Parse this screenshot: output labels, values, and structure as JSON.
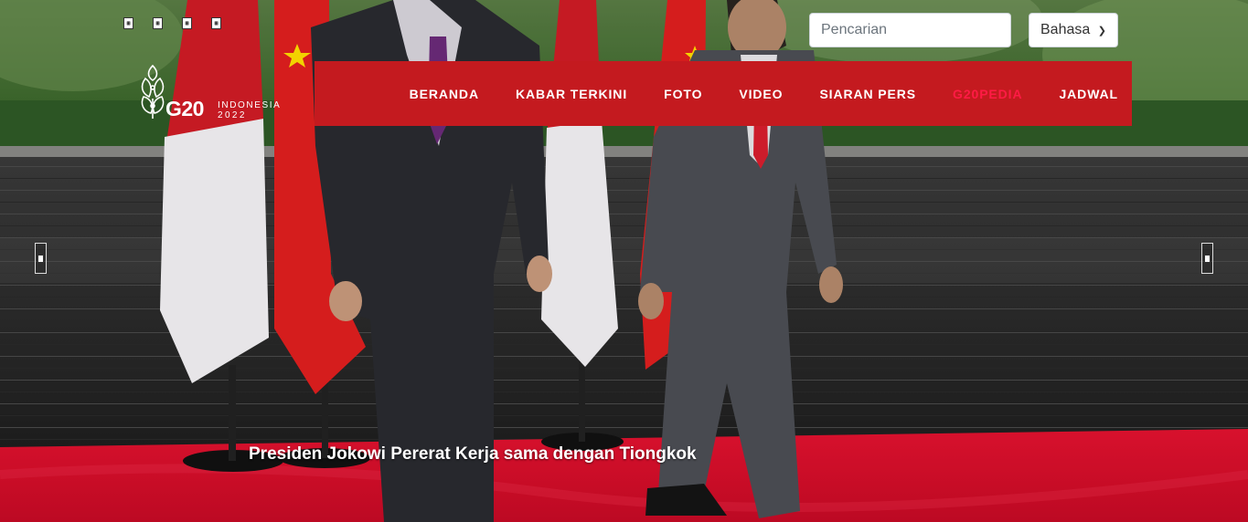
{
  "top_icons": [
    "icon-1",
    "icon-2",
    "icon-3",
    "icon-4"
  ],
  "search": {
    "placeholder": "Pencarian"
  },
  "language": {
    "selected": "Bahasa"
  },
  "logo": {
    "word": "G20",
    "country": "INDONESIA",
    "year": "2022"
  },
  "nav": {
    "items": [
      {
        "label": "BERANDA"
      },
      {
        "label": "KABAR TERKINI"
      },
      {
        "label": "FOTO"
      },
      {
        "label": "VIDEO"
      },
      {
        "label": "SIARAN PERS"
      },
      {
        "label": "G20PEDIA"
      },
      {
        "label": "JADWAL"
      }
    ],
    "active_index": 5
  },
  "hero": {
    "caption": "Presiden Jokowi Pererat Kerja sama dengan Tiongkok"
  },
  "colors": {
    "nav_bg": "#c41a1f",
    "nav_active": "#ff1b45",
    "carpet": "#e3102e"
  }
}
